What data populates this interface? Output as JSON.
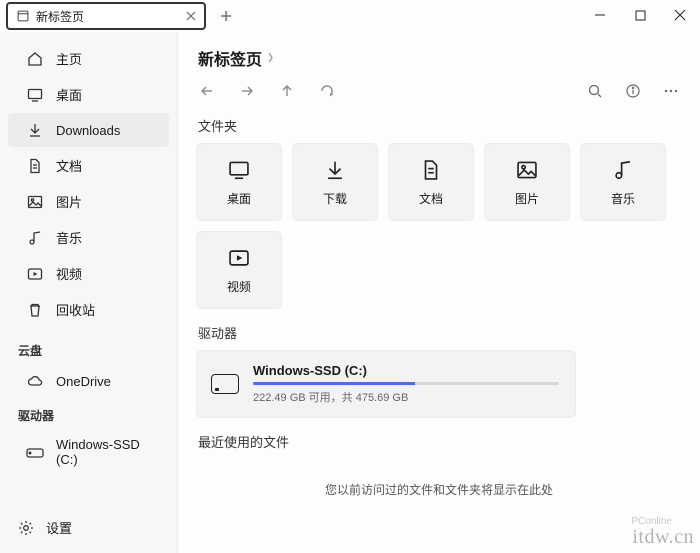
{
  "tab": {
    "title": "新标签页"
  },
  "breadcrumb": {
    "current": "新标签页"
  },
  "sidebar": {
    "items": [
      {
        "label": "主页"
      },
      {
        "label": "桌面"
      },
      {
        "label": "Downloads"
      },
      {
        "label": "文档"
      },
      {
        "label": "图片"
      },
      {
        "label": "音乐"
      },
      {
        "label": "视频"
      },
      {
        "label": "回收站"
      }
    ],
    "cloud_heading": "云盘",
    "cloud": [
      {
        "label": "OneDrive"
      }
    ],
    "drives_heading": "驱动器",
    "drives": [
      {
        "label": "Windows-SSD (C:)"
      }
    ],
    "settings_label": "设置"
  },
  "sections": {
    "folders": "文件夹",
    "drives": "驱动器",
    "recent": "最近使用的文件"
  },
  "folders": [
    {
      "label": "桌面"
    },
    {
      "label": "下载"
    },
    {
      "label": "文档"
    },
    {
      "label": "图片"
    },
    {
      "label": "音乐"
    },
    {
      "label": "视频"
    }
  ],
  "drive_card": {
    "name": "Windows-SSD (C:)",
    "free": "222.49 GB 可用，共 475.69 GB",
    "used_pct": 53
  },
  "recent_empty": "您以前访问过的文件和文件夹将显示在此处",
  "watermark": "itdw.cn",
  "pconline": "PConline"
}
